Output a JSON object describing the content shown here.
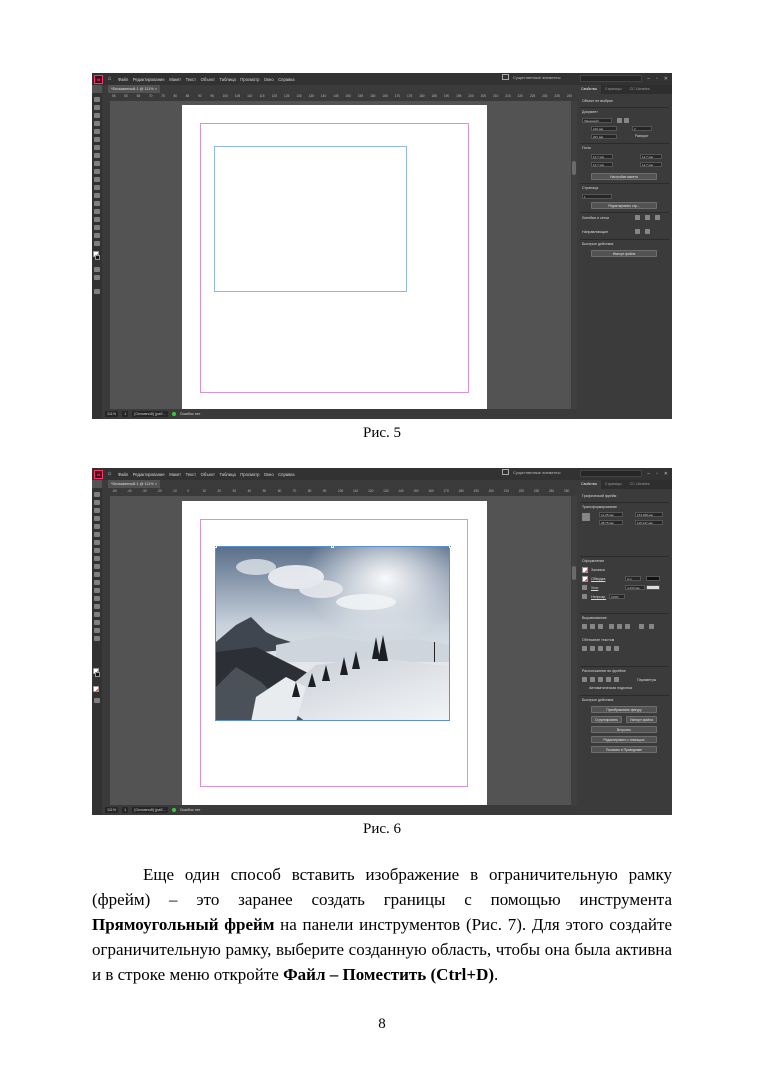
{
  "app": {
    "logo_text": "Id",
    "menu": [
      "Файл",
      "Редактирование",
      "Макет",
      "Текст",
      "Объект",
      "Таблица",
      "Просмотр",
      "Окно",
      "Справка"
    ],
    "workspace": "Существенные элементы",
    "window_controls": [
      "–",
      "▫",
      "✕"
    ]
  },
  "screenshot1": {
    "doc_tab": "*Безымянный-1 @ 111% ×",
    "ruler_ticks": [
      "55",
      "60",
      "65",
      "70",
      "75",
      "80",
      "85",
      "90",
      "95",
      "100",
      "105",
      "110",
      "115",
      "120",
      "125",
      "130",
      "135",
      "140",
      "145",
      "150",
      "155",
      "160",
      "165",
      "170",
      "175",
      "180",
      "185",
      "190",
      "195",
      "200",
      "205",
      "210",
      "215",
      "220",
      "225",
      "230",
      "235",
      "240"
    ],
    "status": {
      "zoom": "111%",
      "page": "1",
      "style": "[Основной] (раб...",
      "errors": "Ошибок нет"
    },
    "panel": {
      "tabs": [
        "Свойства",
        "Страницы",
        "CC Libraries"
      ],
      "selection": "Объект не выбран",
      "document_label": "Документ",
      "preset": "[Заказной]",
      "width": "210 мм",
      "height": "297 мм",
      "pages_count": "2",
      "facing_label": "Разворот",
      "margins_label": "Поля",
      "margin_values": [
        "12,7 мм",
        "12,7 мм",
        "12,7 мм",
        "12,7 мм"
      ],
      "adjust_layout": "Настройки макета",
      "pages_label": "Страница",
      "page_value": "1",
      "edit_master": "Редактировать стр...",
      "align_label": "Линейки и сетки",
      "guides_label": "Направляющие",
      "quick_actions": "Быстрые действия",
      "import_file": "Импорт файла"
    }
  },
  "screenshot2": {
    "doc_tab": "*Безымянный-1 @ 111% ×",
    "ruler_ticks": [
      "-50",
      "-40",
      "-30",
      "-20",
      "-10",
      "0",
      "10",
      "20",
      "30",
      "40",
      "50",
      "60",
      "70",
      "80",
      "90",
      "100",
      "110",
      "120",
      "130",
      "140",
      "150",
      "160",
      "170",
      "180",
      "190",
      "200",
      "210",
      "220",
      "230",
      "240",
      "250"
    ],
    "status": {
      "zoom": "111%",
      "page": "1",
      "style": "[Основной] (раб...",
      "errors": "Ошибок нет"
    },
    "panel": {
      "tabs": [
        "Свойства",
        "Страницы",
        "CC Libraries"
      ],
      "selection": "Графический фрейм",
      "transform_label": "Трансформирование",
      "x": "12,25 мм",
      "y": "28,75 мм",
      "w": "153,928 мм",
      "h": "115,147 мм",
      "appearance_label": "Оформление",
      "fill_label": "Заливка",
      "stroke_label": "Обводка",
      "stroke_weight": "0 пт",
      "corner_label": "Угол",
      "corner_value": "4,233 мм",
      "opacity_label": "Непрозр.",
      "opacity_value": "100%",
      "align_label": "Выравнивание",
      "wrap_label": "Обтекание текстом",
      "frame_fit_label": "Подгонка",
      "fit_frame_label": "Расположение во фрейме",
      "params_label": "Параметры",
      "auto_fit": "Автоматическая подгонка",
      "quick_actions": "Быстрые действия",
      "convert_shape": "Преобразовать фигуру",
      "group": "Сгруппировать",
      "embed": "Импорт файла",
      "embed2": "Встроить",
      "edit_original": "Редактировать с помощью",
      "reveal": "Показать в Проводнике"
    }
  },
  "captions": {
    "fig5": "Рис. 5",
    "fig6": "Рис. 6"
  },
  "body": {
    "t1": "Еще один способ вставить изображение в ограничительную рамку (фрейм) – это заранее создать границы с помощью инструмента ",
    "b1": "Прямоугольный фрейм",
    "t2": " на панели инструментов (Рис. 7). Для этого создайте ограничительную рамку, выберите созданную область, чтобы она была активна и в строке меню откройте ",
    "b2": "Файл – Поместить (Ctrl+D)",
    "t3": "."
  },
  "page_number": "8"
}
